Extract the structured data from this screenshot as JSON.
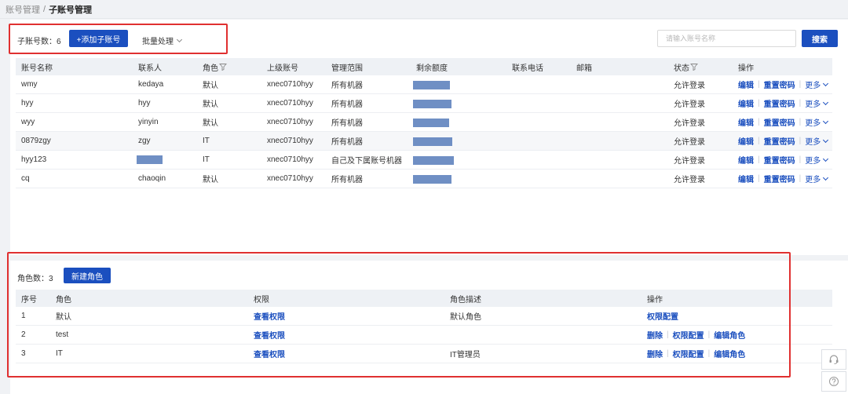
{
  "breadcrumb": {
    "parent": "账号管理",
    "separator": "/",
    "current": "子账号管理"
  },
  "subaccounts": {
    "count_label": "子账号数：6",
    "add_button": "+添加子账号",
    "batch_label": "批量处理",
    "search_placeholder": "请输入账号名称",
    "search_button": "搜索",
    "columns": [
      "账号名称",
      "联系人",
      "角色",
      "上级账号",
      "管理范围",
      "剩余额度",
      "联系电话",
      "邮箱",
      "状态",
      "操作"
    ],
    "rows": [
      {
        "name": "wmy",
        "contact": "kedaya",
        "role": "默认",
        "parent": "xnec0710hyy",
        "scope": "所有机器",
        "status": "允许登录",
        "quota": 0.9
      },
      {
        "name": "hyy",
        "contact": "hyy",
        "role": "默认",
        "parent": "xnec0710hyy",
        "scope": "所有机器",
        "status": "允许登录",
        "quota": 0.95
      },
      {
        "name": "wyy",
        "contact": "yinyin",
        "role": "默认",
        "parent": "xnec0710hyy",
        "scope": "所有机器",
        "status": "允许登录",
        "quota": 0.88
      },
      {
        "name": "0879zgy",
        "contact": "zgy",
        "role": "IT",
        "parent": "xnec0710hyy",
        "scope": "所有机器",
        "status": "允许登录",
        "quota": 0.96
      },
      {
        "name": "hyy123",
        "contact": "",
        "role": "IT",
        "parent": "xnec0710hyy",
        "scope": "自己及下属账号机器",
        "status": "允许登录",
        "quota": 1.0
      },
      {
        "name": "cq",
        "contact": "chaoqin",
        "role": "默认",
        "parent": "xnec0710hyy",
        "scope": "所有机器",
        "status": "允许登录",
        "quota": 0.94
      }
    ],
    "actions": {
      "edit": "编辑",
      "reset_password": "重置密码",
      "more": "更多"
    }
  },
  "roles": {
    "count_label": "角色数：3",
    "new_button": "新建角色",
    "columns": [
      "序号",
      "角色",
      "权限",
      "角色描述",
      "操作"
    ],
    "rows": [
      {
        "index": "1",
        "role": "默认",
        "permission": "查看权限",
        "description": "默认角色",
        "actions": [
          "权限配置"
        ]
      },
      {
        "index": "2",
        "role": "test",
        "permission": "查看权限",
        "description": "",
        "actions": [
          "删除",
          "权限配置",
          "编辑角色"
        ]
      },
      {
        "index": "3",
        "role": "IT",
        "permission": "查看权限",
        "description": "IT管理员",
        "actions": [
          "删除",
          "权限配置",
          "编辑角色"
        ]
      }
    ]
  },
  "colors": {
    "primary": "#1b4fbf",
    "highlight": "#e03030",
    "redaction": "#6f8fc4"
  }
}
